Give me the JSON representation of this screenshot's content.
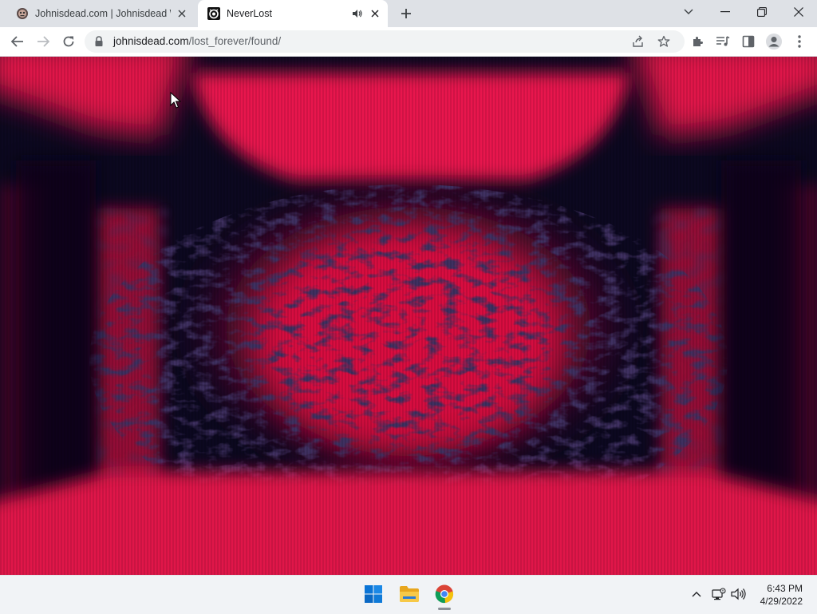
{
  "browser": {
    "tabs": [
      {
        "title": "Johnisdead.com | Johnisdead Wiki",
        "favicon": "johnisdead-wiki-favicon",
        "active": false
      },
      {
        "title": "NeverLost",
        "favicon": "neverlost-favicon",
        "active": true,
        "audio": true
      }
    ],
    "url_host": "johnisdead.com",
    "url_path": "/lost_forever/found/",
    "window_controls": [
      "tab-search-icon",
      "minimize-icon",
      "restore-icon",
      "close-icon"
    ]
  },
  "toolbar_icons": [
    "back-icon",
    "forward-icon",
    "reload-icon",
    "lock-icon",
    "share-icon",
    "bookmark-star-icon",
    "extensions-icon",
    "media-control-icon",
    "side-panel-icon",
    "profile-icon",
    "menu-icon"
  ],
  "page": {
    "description_colors": {
      "red": "#e0134a",
      "dark": "#0c0820"
    }
  },
  "taskbar": {
    "apps": [
      "windows-start-icon",
      "file-explorer-icon",
      "chrome-icon"
    ],
    "tray_icons": [
      "show-hidden-icons-chevron-icon",
      "network-icon",
      "volume-icon"
    ],
    "time": "6:43 PM",
    "date": "4/29/2022"
  }
}
